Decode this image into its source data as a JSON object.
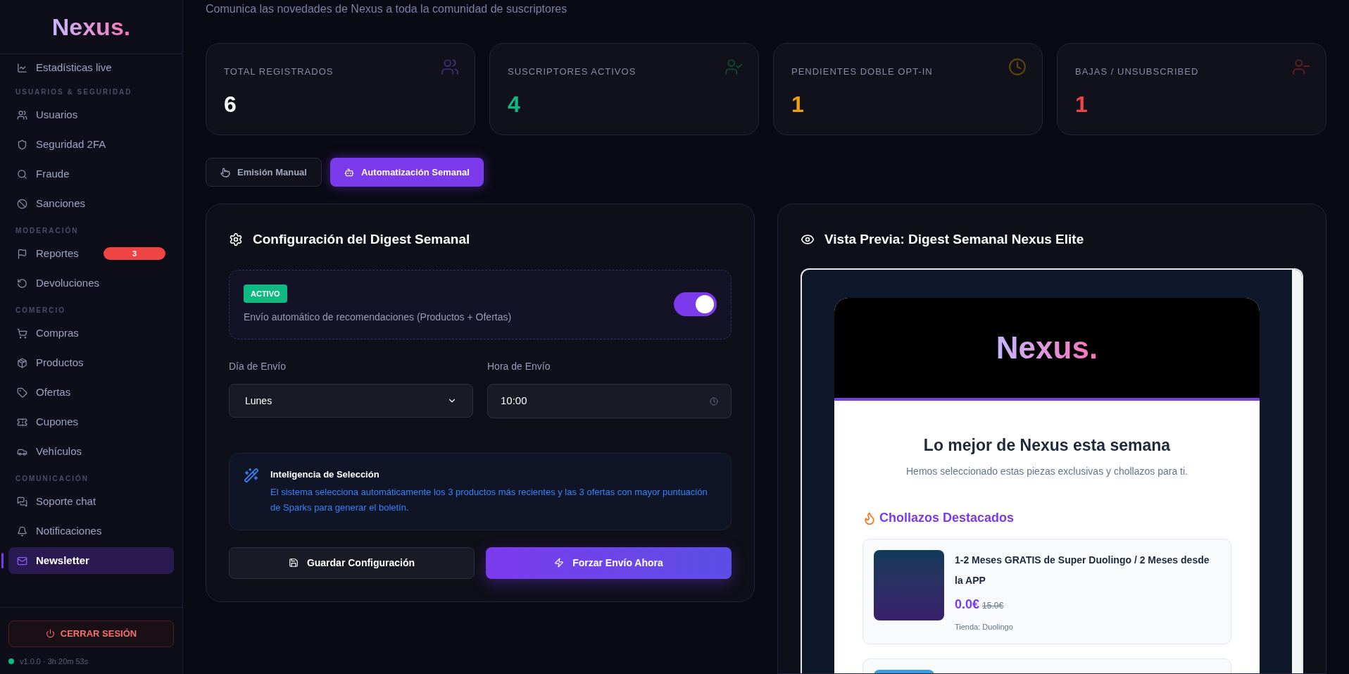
{
  "sidebar": {
    "logo": "Nexus.",
    "top_item": {
      "label": "Estadísticas live",
      "selected": false
    },
    "sections": [
      {
        "title": "USUARIOS & SEGURIDAD",
        "items": [
          {
            "label": "Usuarios",
            "selected": false
          },
          {
            "label": "Seguridad 2FA",
            "selected": false
          },
          {
            "label": "Fraude",
            "selected": false
          },
          {
            "label": "Sanciones",
            "selected": false
          }
        ]
      },
      {
        "title": "MODERACIÓN",
        "items": [
          {
            "label": "Reportes",
            "selected": false,
            "badge": "3"
          },
          {
            "label": "Devoluciones",
            "selected": false
          }
        ]
      },
      {
        "title": "COMERCIO",
        "items": [
          {
            "label": "Compras",
            "selected": false
          },
          {
            "label": "Productos",
            "selected": false
          },
          {
            "label": "Ofertas",
            "selected": false
          },
          {
            "label": "Cupones",
            "selected": false
          },
          {
            "label": "Vehículos",
            "selected": false
          }
        ]
      },
      {
        "title": "COMUNICACIÓN",
        "items": [
          {
            "label": "Soporte chat",
            "selected": false
          },
          {
            "label": "Notificaciones",
            "selected": false
          },
          {
            "label": "Newsletter",
            "selected": true
          }
        ]
      }
    ],
    "logout": "CERRAR SESIÓN",
    "version": "v1.0.0 · 3h 20m 53s"
  },
  "subtitle": "Comunica las novedades de Nexus a toda la comunidad de suscriptores",
  "stats": [
    {
      "label": "TOTAL REGISTRADOS",
      "value": "6",
      "color": "#ffffff"
    },
    {
      "label": "SUSCRIPTORES ACTIVOS",
      "value": "4",
      "color": "#10b981"
    },
    {
      "label": "PENDIENTES DOBLE OPT-IN",
      "value": "1",
      "color": "#f59e0b"
    },
    {
      "label": "BAJAS / UNSUBSCRIBED",
      "value": "1",
      "color": "#ef4444"
    }
  ],
  "tabs": [
    {
      "label": "Emisión Manual",
      "selected": false
    },
    {
      "label": "Automatización Semanal",
      "selected": true
    }
  ],
  "config": {
    "title": "Configuración del Digest Semanal",
    "status_badge": "ACTIVO",
    "description": "Envío automático de recomendaciones (Productos + Ofertas)",
    "on": true,
    "day_label": "Día de Envío",
    "day_value": "Lunes",
    "time_label": "Hora de Envío",
    "time_value": "10:00",
    "info_title": "Inteligencia de Selección",
    "info_text": "El sistema selecciona automáticamente los 3 productos más recientes y las 3 ofertas con mayor puntuación de Sparks para generar el boletín.",
    "save_button": "Guardar Configuración",
    "force_button": "Forzar Envío Ahora"
  },
  "preview": {
    "title": "Vista Previa: Digest Semanal Nexus Elite",
    "logo": "Nexus.",
    "heading": "Lo mejor de Nexus esta semana",
    "subheading": "Hemos seleccionado estas piezas exclusivas y chollazos para ti.",
    "section_title": "Chollazos Destacados",
    "deals": [
      {
        "title": "1-2 Meses GRATIS de Super Duolingo / 2 Meses desde la APP",
        "price": "0.0€",
        "old_price": "15.0€",
        "store": "Tienda: Duolingo"
      }
    ]
  }
}
